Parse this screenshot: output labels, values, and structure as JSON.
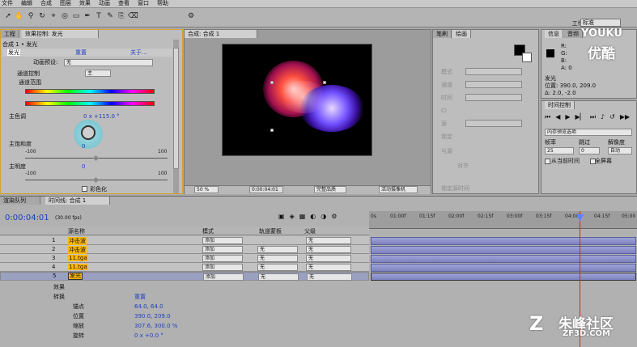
{
  "menu": [
    "文件",
    "编辑",
    "合成",
    "图层",
    "效果",
    "动画",
    "查看",
    "窗口",
    "帮助"
  ],
  "toolbar": {
    "workspace_label": "工作区域:",
    "workspace_value": "标准"
  },
  "effects_panel": {
    "tabs": [
      "工程",
      "效果控制: 发光"
    ],
    "title": "合成 1 • 发光",
    "effect_name": "发光",
    "reset": "重置",
    "about": "关于...",
    "preset_label": "动画预设:",
    "preset_value": "无",
    "channel_label": "通道控制",
    "channel_value": "主",
    "range_label": "通道范围",
    "hue_label": "主色调",
    "hue_value": "0 x +115.0 °",
    "hue_sub_value": "0",
    "sat_label": "主饱和度",
    "sat_min": "-100",
    "sat_max": "100",
    "sat_value": "0",
    "light_label": "主明度",
    "light_min": "-100",
    "light_max": "100",
    "light_value": "0",
    "colorize_label": "彩色化"
  },
  "comp_panel": {
    "tab": "合成: 合成 1",
    "zoom": "50 %",
    "timecode": "0:00:04:01",
    "quality": "完整品质",
    "camera": "活动摄像机"
  },
  "char_panel": {
    "tabs": [
      "笔刷",
      "绘画"
    ],
    "labels": [
      "模式",
      "通道",
      "时间",
      "Cl",
      "源",
      "锁定",
      "与源",
      "对齐",
      "锁定源时间"
    ]
  },
  "info_panel": {
    "tabs": [
      "信息",
      "音频"
    ],
    "layer_name": "发光",
    "position": "位置: 390.0, 209.0",
    "delta": "Δ: 2.0, -2.0",
    "values": [
      "R:",
      "G:",
      "B:",
      "A: 0"
    ]
  },
  "time_control": {
    "tab": "时间控制",
    "ram_label": "内存预览选项",
    "fps_label": "帧率",
    "skip_label": "跳过",
    "res_label": "解像度",
    "fps_value": "25",
    "skip_value": "0",
    "res_value": "自动",
    "from_current": "从当前时间",
    "full_screen": "全屏幕"
  },
  "timeline": {
    "tabs": [
      "渲染队列",
      "时间线: 合成 1"
    ],
    "timecode": "0:00:04:01",
    "fps": "(30.00 fps)",
    "headers": {
      "source": "源名称",
      "mode": "模式",
      "trkmat": "轨道蒙板",
      "parent": "父级"
    },
    "layers": [
      {
        "num": "1",
        "name": "冲击波",
        "mode": "添加",
        "trk": "",
        "parent": "无"
      },
      {
        "num": "2",
        "name": "冲击波",
        "mode": "添加",
        "trk": "无",
        "parent": "无"
      },
      {
        "num": "3",
        "name": "11.tga",
        "mode": "添加",
        "trk": "无",
        "parent": "无"
      },
      {
        "num": "4",
        "name": "11.tga",
        "mode": "添加",
        "trk": "无",
        "parent": "无"
      },
      {
        "num": "5",
        "name": "发光",
        "mode": "添加",
        "trk": "无",
        "parent": "无"
      }
    ],
    "props": {
      "effects": "效果",
      "transform": "转换",
      "reset": "重置",
      "anchor": "锚点",
      "anchor_value": "64.0, 64.0",
      "position": "位置",
      "position_value": "390.0, 209.0",
      "scale": "缩放",
      "scale_value": "307.6, 300.0 %",
      "rotation": "旋转",
      "rotation_value": "0 x +0.0 °"
    },
    "ruler": [
      "0s",
      "01:00f",
      "01:15f",
      "02:00f",
      "02:15f",
      "03:00f",
      "03:15f",
      "04:00f",
      "04:15f",
      "05:00"
    ]
  },
  "watermarks": {
    "youku": "YOUKU",
    "youku_cn": "优酷",
    "zf": "朱峰社区",
    "zf_url": "ZF3D.COM"
  }
}
